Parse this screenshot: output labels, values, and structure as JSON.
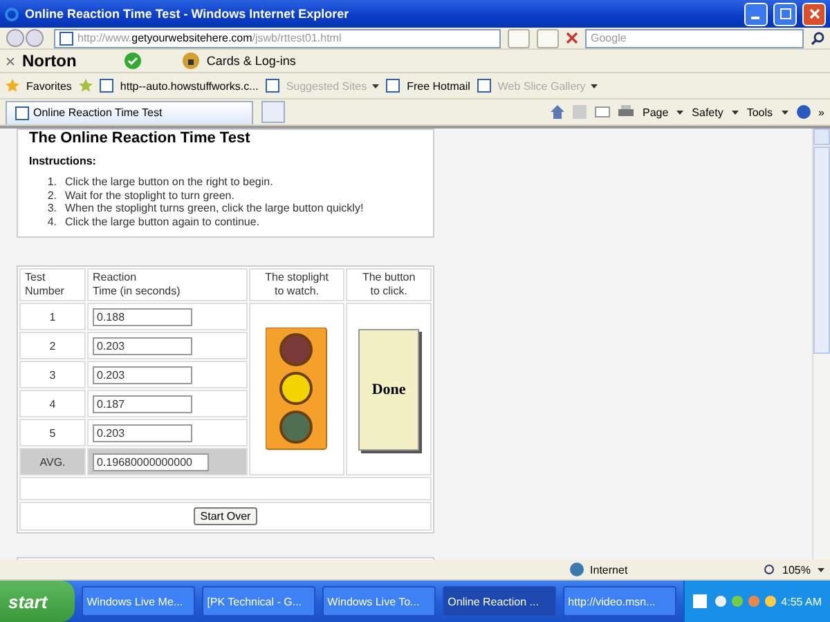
{
  "window": {
    "title": "Online Reaction Time Test - Windows Internet Explorer"
  },
  "address_bar": {
    "url_prefix": "http://www.",
    "url_host": "getyourwebsitehere.com",
    "url_path": "/jswb/rttest01.html",
    "search_placeholder": "Google"
  },
  "norton_toolbar": {
    "brand": "Norton",
    "items": [
      "Cards & Log-ins"
    ]
  },
  "favorites_bar": {
    "label": "Favorites",
    "items": [
      {
        "label": "http--auto.howstuffworks.c...",
        "disabled": false,
        "dropdown": false
      },
      {
        "label": "Suggested Sites",
        "disabled": true,
        "dropdown": true
      },
      {
        "label": "Free Hotmail",
        "disabled": false,
        "dropdown": false
      },
      {
        "label": "Web Slice Gallery",
        "disabled": true,
        "dropdown": true
      }
    ]
  },
  "tabs": [
    {
      "label": "Online Reaction Time Test",
      "selected": true
    }
  ],
  "command_bar": {
    "menus": [
      "Page",
      "Safety",
      "Tools"
    ],
    "overflow": "»"
  },
  "page": {
    "heading": "The Online Reaction Time Test",
    "instructions_label": "Instructions:",
    "steps": [
      {
        "number": "1.",
        "text": "Click the large button on the right to begin."
      },
      {
        "number": "2.",
        "text": "Wait for the stoplight to turn green."
      },
      {
        "number": "3.",
        "text": "When the stoplight turns green, click the large button quickly!"
      },
      {
        "number": "4.",
        "text": "Click the large button again to continue."
      }
    ],
    "table": {
      "columns": [
        {
          "lines": [
            "Test",
            "Number"
          ]
        },
        {
          "lines": [
            "Reaction",
            "Time (in seconds)"
          ]
        },
        {
          "lines": [
            "The stoplight",
            "to watch."
          ]
        },
        {
          "lines": [
            "The button",
            "to click."
          ]
        }
      ],
      "rows": [
        {
          "number": "1",
          "time": "0.188"
        },
        {
          "number": "2",
          "time": "0.203"
        },
        {
          "number": "3",
          "time": "0.203"
        },
        {
          "number": "4",
          "time": "0.187"
        },
        {
          "number": "5",
          "time": "0.203"
        }
      ],
      "average": {
        "label": "AVG.",
        "value": "0.19680000000000"
      }
    },
    "stoplight": [
      {
        "kind": "red",
        "on": false
      },
      {
        "kind": "yellow",
        "on": true
      },
      {
        "kind": "green",
        "on": false
      }
    ],
    "done_button": "Done",
    "start_over_button": "Start Over"
  },
  "status_bar": {
    "zone": "Internet",
    "zoom": "105%"
  },
  "taskbar": {
    "start": "start",
    "items": [
      {
        "label": "Windows Live Me...",
        "selected": false
      },
      {
        "label": "[PK Technical - G...",
        "selected": false
      },
      {
        "label": "Windows Live To...",
        "selected": false
      },
      {
        "label": "Online Reaction ...",
        "selected": true
      },
      {
        "label": "http://video.msn...",
        "selected": false
      }
    ],
    "clock": "4:55 AM"
  }
}
